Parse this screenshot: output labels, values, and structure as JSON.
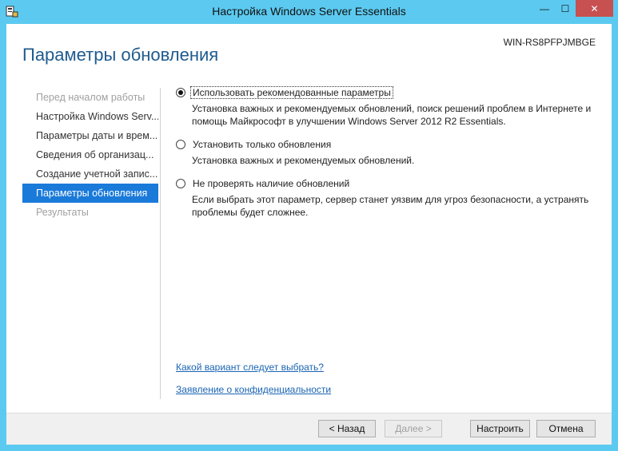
{
  "window": {
    "title": "Настройка Windows Server Essentials",
    "controls": {
      "minimize": "—",
      "maximize": "☐",
      "close": "✕"
    }
  },
  "header": {
    "server_name": "WIN-RS8PFPJMBGE",
    "page_title": "Параметры обновления"
  },
  "nav": {
    "items": [
      {
        "label": "Перед началом работы",
        "state": "disabled"
      },
      {
        "label": "Настройка Windows Serv...",
        "state": "normal"
      },
      {
        "label": "Параметры даты и врем...",
        "state": "normal"
      },
      {
        "label": "Сведения об организац...",
        "state": "normal"
      },
      {
        "label": "Создание учетной запис...",
        "state": "normal"
      },
      {
        "label": "Параметры обновления",
        "state": "active"
      },
      {
        "label": "Результаты",
        "state": "disabled"
      }
    ]
  },
  "options": [
    {
      "label": "Использовать рекомендованные параметры",
      "description": "Установка важных и рекомендуемых обновлений, поиск решений проблем в Интернете и помощь Майкрософт в улучшении Windows Server 2012 R2 Essentials.",
      "selected": true
    },
    {
      "label": "Установить только обновления",
      "description": "Установка важных и рекомендуемых обновлений.",
      "selected": false
    },
    {
      "label": "Не проверять наличие обновлений",
      "description": "Если выбрать этот параметр, сервер станет уязвим для угроз безопасности, а устранять проблемы будет сложнее.",
      "selected": false
    }
  ],
  "links": {
    "which_option": "Какой вариант следует выбрать?",
    "privacy": "Заявление о конфиденциальности"
  },
  "footer": {
    "back": "< Назад",
    "next": "Далее >",
    "configure": "Настроить",
    "cancel": "Отмена"
  },
  "colors": {
    "frame": "#5ccaf0",
    "title_accent": "#1e5b8f",
    "nav_active": "#1a7ad9",
    "link": "#1a64b3",
    "close_button": "#c75050"
  }
}
